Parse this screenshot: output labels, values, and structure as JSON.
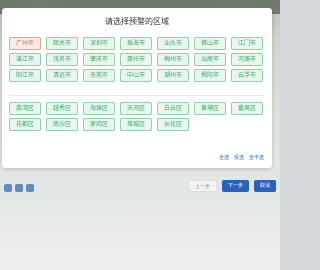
{
  "dialog": {
    "title": "请选择预警的区域",
    "cities": [
      {
        "label": "广州市",
        "active": true
      },
      {
        "label": "韶关市",
        "active": false
      },
      {
        "label": "深圳市",
        "active": false
      },
      {
        "label": "珠海市",
        "active": false
      },
      {
        "label": "汕头市",
        "active": false
      },
      {
        "label": "佛山市",
        "active": false
      },
      {
        "label": "江门市",
        "active": false
      },
      {
        "label": "湛江市",
        "active": false
      },
      {
        "label": "茂名市",
        "active": false
      },
      {
        "label": "肇庆市",
        "active": false
      },
      {
        "label": "惠州市",
        "active": false
      },
      {
        "label": "梅州市",
        "active": false
      },
      {
        "label": "汕尾市",
        "active": false
      },
      {
        "label": "河源市",
        "active": false
      },
      {
        "label": "阳江市",
        "active": false
      },
      {
        "label": "清远市",
        "active": false
      },
      {
        "label": "东莞市",
        "active": false
      },
      {
        "label": "中山市",
        "active": false
      },
      {
        "label": "潮州市",
        "active": false
      },
      {
        "label": "揭阳市",
        "active": false
      },
      {
        "label": "云浮市",
        "active": false
      }
    ],
    "districts": [
      "荔湾区",
      "越秀区",
      "海珠区",
      "天河区",
      "白云区",
      "黄埔区",
      "番禺区",
      "花都区",
      "南沙区",
      "萝岗区",
      "增城区",
      "从化区"
    ],
    "links": {
      "select_all": "全选",
      "invert": "反选",
      "select_none": "全不选"
    }
  },
  "nav": {
    "prev": "上一步",
    "next": "下一步",
    "back": "取消"
  },
  "colors": {
    "chip_green": "#3aa56a",
    "chip_active": "#e0653a",
    "accent_blue": "#2a62b8"
  }
}
